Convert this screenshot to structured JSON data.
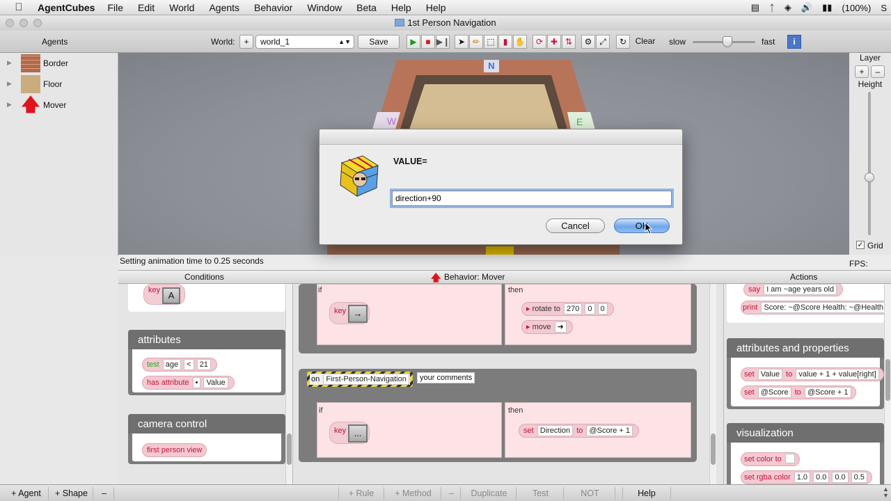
{
  "menubar": {
    "app_name": "AgentCubes",
    "items": [
      "File",
      "Edit",
      "World",
      "Agents",
      "Behavior",
      "Window",
      "Beta",
      "Help",
      "Help"
    ],
    "battery": "(100%)",
    "clock_partial": "S"
  },
  "window": {
    "title": "1st Person Navigation"
  },
  "toolbar": {
    "agents_label": "Agents",
    "world_label": "World:",
    "world_select": "world_1",
    "save_label": "Save",
    "clear_label": "Clear",
    "slow_label": "slow",
    "fast_label": "fast",
    "speed_level": 0.55
  },
  "agents": [
    {
      "name": "Border",
      "icon": "brick-wall-icon"
    },
    {
      "name": "Floor",
      "icon": "sand-floor-icon"
    },
    {
      "name": "Mover",
      "icon": "red-arrow-icon"
    }
  ],
  "world": {
    "compass_labels": [
      "N",
      "W",
      "E"
    ]
  },
  "layer_panel": {
    "title": "Layer",
    "height_label": "Height",
    "grid_label": "Grid",
    "grid_checked": true,
    "fps_label": "FPS:"
  },
  "status": "Setting animation time to 0.25 seconds",
  "panes": {
    "conditions": "Conditions",
    "behavior": "Behavior: Mover",
    "actions": "Actions"
  },
  "conditions": {
    "key_top_label": "key",
    "key_top_cap": "A",
    "attributes_title": "attributes",
    "test_word": "test",
    "test_left": "age",
    "test_op": "<",
    "test_right": "21",
    "has_attribute_label": "has attribute",
    "has_attribute_dot": "•",
    "has_attribute_value": "Value",
    "camera_title": "camera control",
    "first_person_view": "first person view"
  },
  "behavior": {
    "rule1": {
      "if_label": "if",
      "then_label": "then",
      "key_label": "key",
      "key_cap": "→",
      "rotate_label": "rotate to",
      "rotate_values": [
        "270",
        "0",
        "0"
      ],
      "move_label": "move",
      "move_arrow": "➜"
    },
    "method": {
      "on_label": "on",
      "method_name": "First-Person-Navigation",
      "comment": "your comments",
      "if_label": "if",
      "then_label": "then",
      "key_label": "key",
      "key_cap": "...",
      "set_label": "set",
      "set_attr": "Direction",
      "to_label": "to",
      "set_value": "@Score + 1"
    }
  },
  "actions": {
    "say_label": "say",
    "say_value": "I am ~age years old",
    "print_label": "print",
    "print_value": "Score: ~@Score Health: ~@Health",
    "attrs_title": "attributes and properties",
    "set1_label": "set",
    "set1_attr": "Value",
    "set1_to": "to",
    "set1_value": "value + 1 + value[right]",
    "set2_label": "set",
    "set2_attr": "@Score",
    "set2_to": "to",
    "set2_value": "@Score + 1",
    "viz_title": "visualization",
    "set_color_label": "set color to",
    "rgba_label": "set rgba color",
    "rgba_values": [
      "1.0",
      "0.0",
      "0.0",
      "0.5"
    ]
  },
  "bottombar": {
    "add_agent": "+ Agent",
    "add_shape": "+ Shape",
    "minus": "–",
    "add_rule": "+ Rule",
    "add_method": "+ Method",
    "minus2": "–",
    "duplicate": "Duplicate",
    "test": "Test",
    "not": "NOT",
    "help": "Help"
  },
  "dialog": {
    "label": "VALUE=",
    "input_value": "direction+90",
    "cancel": "Cancel",
    "ok": "OK"
  }
}
